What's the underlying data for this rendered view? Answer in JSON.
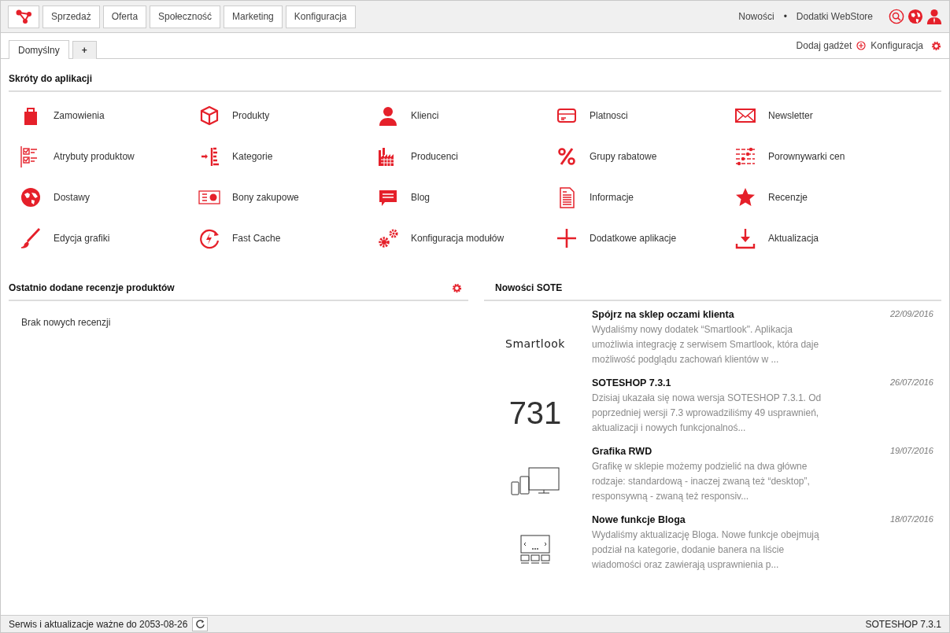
{
  "top_nav": {
    "menu": [
      {
        "label": "Sprzedaż"
      },
      {
        "label": "Oferta"
      },
      {
        "label": "Społeczność"
      },
      {
        "label": "Marketing"
      },
      {
        "label": "Konfiguracja"
      }
    ],
    "links": [
      {
        "label": "Nowości"
      },
      {
        "label": "Dodatki WebStore"
      }
    ],
    "separator": "•"
  },
  "tabs": [
    {
      "label": "Domyślny",
      "selected": true
    },
    {
      "label": "+",
      "selected": false
    }
  ],
  "tab_actions": [
    {
      "label": "Dodaj gadżet"
    },
    {
      "label": "Konfiguracja"
    }
  ],
  "shortcuts": {
    "title": "Skróty do aplikacji",
    "items": [
      {
        "label": "Zamowienia",
        "kind": "bag"
      },
      {
        "label": "Produkty",
        "kind": "box"
      },
      {
        "label": "Klienci",
        "kind": "person"
      },
      {
        "label": "Platnosci",
        "kind": "card"
      },
      {
        "label": "Newsletter",
        "kind": "envelope"
      },
      {
        "label": "Atrybuty produktow",
        "kind": "checklist"
      },
      {
        "label": "Kategorie",
        "kind": "tree"
      },
      {
        "label": "Producenci",
        "kind": "factory"
      },
      {
        "label": "Grupy rabatowe",
        "kind": "percent"
      },
      {
        "label": "Porownywarki cen",
        "kind": "sliders"
      },
      {
        "label": "Dostawy",
        "kind": "globe"
      },
      {
        "label": "Bony zakupowe",
        "kind": "voucher"
      },
      {
        "label": "Blog",
        "kind": "chat"
      },
      {
        "label": "Informacje",
        "kind": "document"
      },
      {
        "label": "Recenzje",
        "kind": "star"
      },
      {
        "label": "Edycja grafiki",
        "kind": "brush"
      },
      {
        "label": "Fast Cache",
        "kind": "bolt"
      },
      {
        "label": "Konfiguracja modułów",
        "kind": "gears"
      },
      {
        "label": "Dodatkowe aplikacje",
        "kind": "plus"
      },
      {
        "label": "Aktualizacja",
        "kind": "download"
      }
    ]
  },
  "reviews_panel": {
    "title": "Ostatnio dodane recenzje produktów",
    "empty_text": "Brak nowych recenzji"
  },
  "news_panel": {
    "title": "Nowości SOTE",
    "items": [
      {
        "title": "Spójrz na sklep oczami klienta",
        "date": "22/09/2016",
        "text": "Wydaliśmy nowy dodatek “Smartlook\". Aplikacja umożliwia integrację z serwisem Smartlook, która daje możliwość podglądu zachowań klientów w ...",
        "thumb": {
          "kind": "logo",
          "text": "Smartlook"
        }
      },
      {
        "title": "SOTESHOP 7.3.1",
        "date": "26/07/2016",
        "text": "Dzisiaj ukazała się nowa wersja SOTESHOP 7.3.1. Od poprzedniej wersji 7.3 wprowadziliśmy 49 usprawnień, aktualizacji i nowych funkcjonalnoś...",
        "thumb": {
          "kind": "number",
          "text": "731"
        }
      },
      {
        "title": "Grafika RWD",
        "date": "19/07/2016",
        "text": "Grafikę w sklepie możemy podzielić na dwa główne rodzaje: standardową - inaczej zwaną też “desktop”, responsywną - zwaną też responsiv...",
        "thumb": {
          "kind": "devices"
        }
      },
      {
        "title": "Nowe funkcje Bloga",
        "date": "18/07/2016",
        "text": "Wydaliśmy aktualizację Bloga. Nowe funkcje obejmują podział na kategorie, dodanie banera na liście wiadomości oraz zawierają usprawnienia p...",
        "thumb": {
          "kind": "slider"
        }
      }
    ]
  },
  "status_bar": {
    "left": "Serwis i aktualizacje ważne do 2053-08-26",
    "right": "SOTESHOP 7.3.1"
  }
}
